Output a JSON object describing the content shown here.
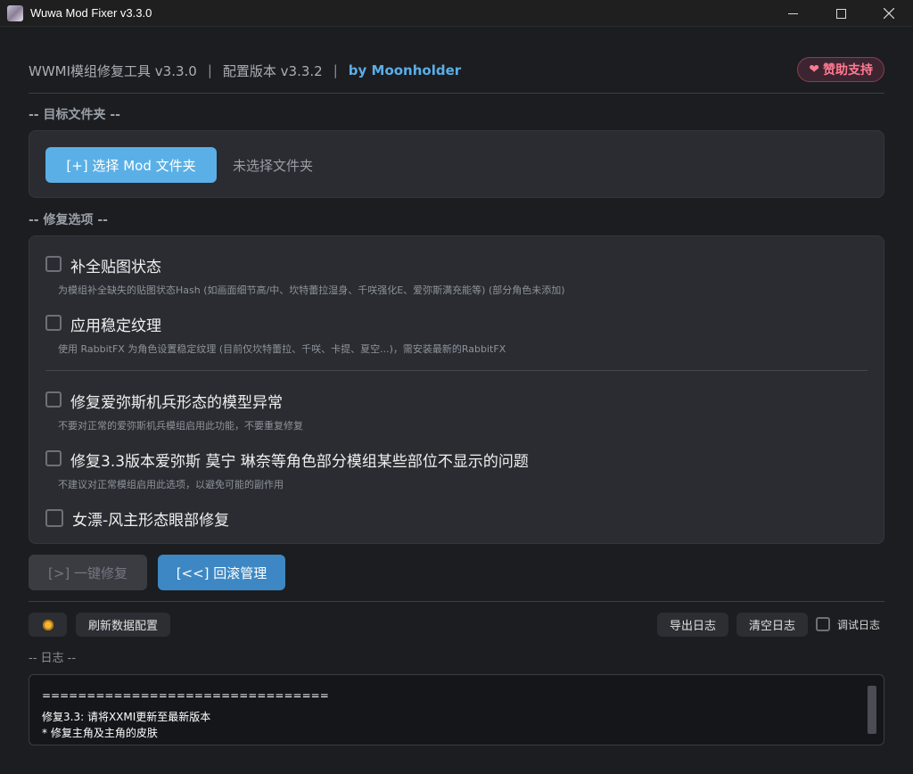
{
  "window": {
    "title": "Wuwa Mod Fixer v3.3.0",
    "controls": [
      "minimize",
      "maximize",
      "close"
    ]
  },
  "header": {
    "app_name": "WWMI模组修复工具  v3.3.0",
    "separator": "|",
    "config_version": "配置版本 v3.3.2",
    "author": "by Moonholder",
    "donate_label": "赞助支持",
    "donate_icon": "❤"
  },
  "target_section": {
    "label": "-- 目标文件夹 --",
    "select_button": "[+] 选择 Mod 文件夹",
    "status": "未选择文件夹"
  },
  "options_section": {
    "label": "-- 修复选项 --",
    "options": [
      {
        "label": "补全贴图状态",
        "description": "为模组补全缺失的贴图状态Hash (如画面细节高/中、坎特蕾拉湿身、千咲强化E、爱弥斯满充能等) (部分角色未添加)",
        "checked": false
      },
      {
        "label": "应用稳定纹理",
        "description": "使用 RabbitFX 为角色设置稳定纹理 (目前仅坎特蕾拉、千咲、卡提、夏空...)，需安装最新的RabbitFX",
        "checked": false
      },
      {
        "label": "修复爱弥斯机兵形态的模型异常",
        "description": "不要对正常的爱弥斯机兵模组启用此功能，不要重复修复",
        "checked": false
      },
      {
        "label": "修复3.3版本爱弥斯 莫宁 琳奈等角色部分模组某些部位不显示的问题",
        "description": "不建议对正常模组启用此选项，以避免可能的副作用",
        "checked": false
      },
      {
        "label": "女漂-风主形态眼部修复",
        "description": "",
        "checked": false
      }
    ]
  },
  "actions": {
    "fix_button": "[>] 一键修复",
    "rollback_button": "[<<] 回滚管理"
  },
  "toolbar": {
    "theme_icon": "sun-icon",
    "refresh_button": "刷新数据配置",
    "export_button": "导出日志",
    "clear_button": "清空日志",
    "debug_label": "调试日志",
    "debug_checked": false
  },
  "log": {
    "label": "-- 日志 --",
    "lines": [
      "================================",
      "修复3.3: 请将XXMI更新至最新版本",
      "* 修复主角及主角的皮肤"
    ]
  },
  "colors": {
    "accent": "#5ab0e6",
    "rollback": "#3d88c4",
    "donate": "#ff7a93",
    "background": "#1c1d20",
    "panel": "#2a2c31"
  }
}
